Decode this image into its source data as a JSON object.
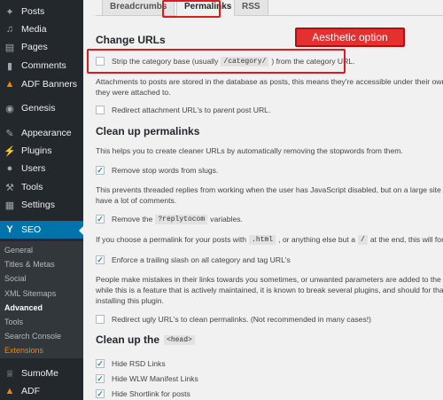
{
  "sidebar": {
    "items": [
      {
        "label": "Posts",
        "icon": "pushpin-icon"
      },
      {
        "label": "Media",
        "icon": "media-icon"
      },
      {
        "label": "Pages",
        "icon": "pages-icon"
      },
      {
        "label": "Comments",
        "icon": "comments-icon"
      },
      {
        "label": "ADF Banners",
        "icon": "banner-icon"
      },
      {
        "label": "Genesis",
        "icon": "genesis-icon"
      },
      {
        "label": "Appearance",
        "icon": "paintbrush-icon"
      },
      {
        "label": "Plugins",
        "icon": "plugins-icon"
      },
      {
        "label": "Users",
        "icon": "users-icon"
      },
      {
        "label": "Tools",
        "icon": "wrench-icon"
      },
      {
        "label": "Settings",
        "icon": "settings-icon"
      },
      {
        "label": "SEO",
        "icon": "yoast-icon"
      },
      {
        "label": "SumoMe",
        "icon": "crown-icon"
      },
      {
        "label": "ADF",
        "icon": "adf-icon"
      }
    ],
    "submenu": [
      "General",
      "Titles & Metas",
      "Social",
      "XML Sitemaps",
      "Advanced",
      "Tools",
      "Search Console",
      "Extensions"
    ],
    "active_color": "#0073aa",
    "extensions_color": "#f18500"
  },
  "tabs": [
    "Breadcrumbs",
    "Permalinks",
    "RSS"
  ],
  "annotation": {
    "label": "Aesthetic option",
    "color": "#e63030"
  },
  "content": {
    "change_urls": {
      "heading": "Change URLs",
      "strip_pre": "Strip the category base (usually",
      "strip_code": "/category/",
      "strip_post": ") from the category URL.",
      "strip_checked": false,
      "attach_line1": "Attachments to posts are stored in the database as posts, this means they're accessible under their own UR",
      "attach_line2": "they were attached to.",
      "redirect_attach": "Redirect attachment URL's to parent post URL.",
      "redirect_attach_checked": false
    },
    "cleanup_permalinks": {
      "heading": "Clean up permalinks",
      "stopwords_desc": "This helps you to create cleaner URLs by automatically removing the stopwords from them.",
      "stopwords": "Remove stop words from slugs.",
      "stopwords_checked": true,
      "replytocom_desc1": "This prevents threaded replies from working when the user has JavaScript disabled, but on a large site can",
      "replytocom_desc2": "have a lot of comments.",
      "replytocom_pre": "Remove the",
      "replytocom_code": "?replytocom",
      "replytocom_post": "variables.",
      "replytocom_checked": true,
      "slash_desc_pre": "If you choose a permalink for your posts with",
      "slash_desc_code1": ".html",
      "slash_desc_mid": ", or anything else but a",
      "slash_desc_code2": "/",
      "slash_desc_post": "at the end, this will force W",
      "slash": "Enforce a trailing slash on all category and tag URL's",
      "slash_checked": true,
      "ugly_desc1": "People make mistakes in their links towards you sometimes, or unwanted parameters are added to the end",
      "ugly_desc2": "while this is a feature that is actively maintained, it is known to break several plugins, and should for that rea",
      "ugly_desc3": "installing this plugin.",
      "ugly": "Redirect ugly URL's to clean permalinks. (Not recommended in many cases!)",
      "ugly_checked": false
    },
    "cleanup_head": {
      "heading_pre": "Clean up the",
      "heading_code": "<head>",
      "rsd": "Hide RSD Links",
      "wlw": "Hide WLW Manifest Links",
      "shortlink": "Hide Shortlink for posts",
      "rsd_checked": true,
      "wlw_checked": true,
      "shortlink_checked": true
    }
  }
}
